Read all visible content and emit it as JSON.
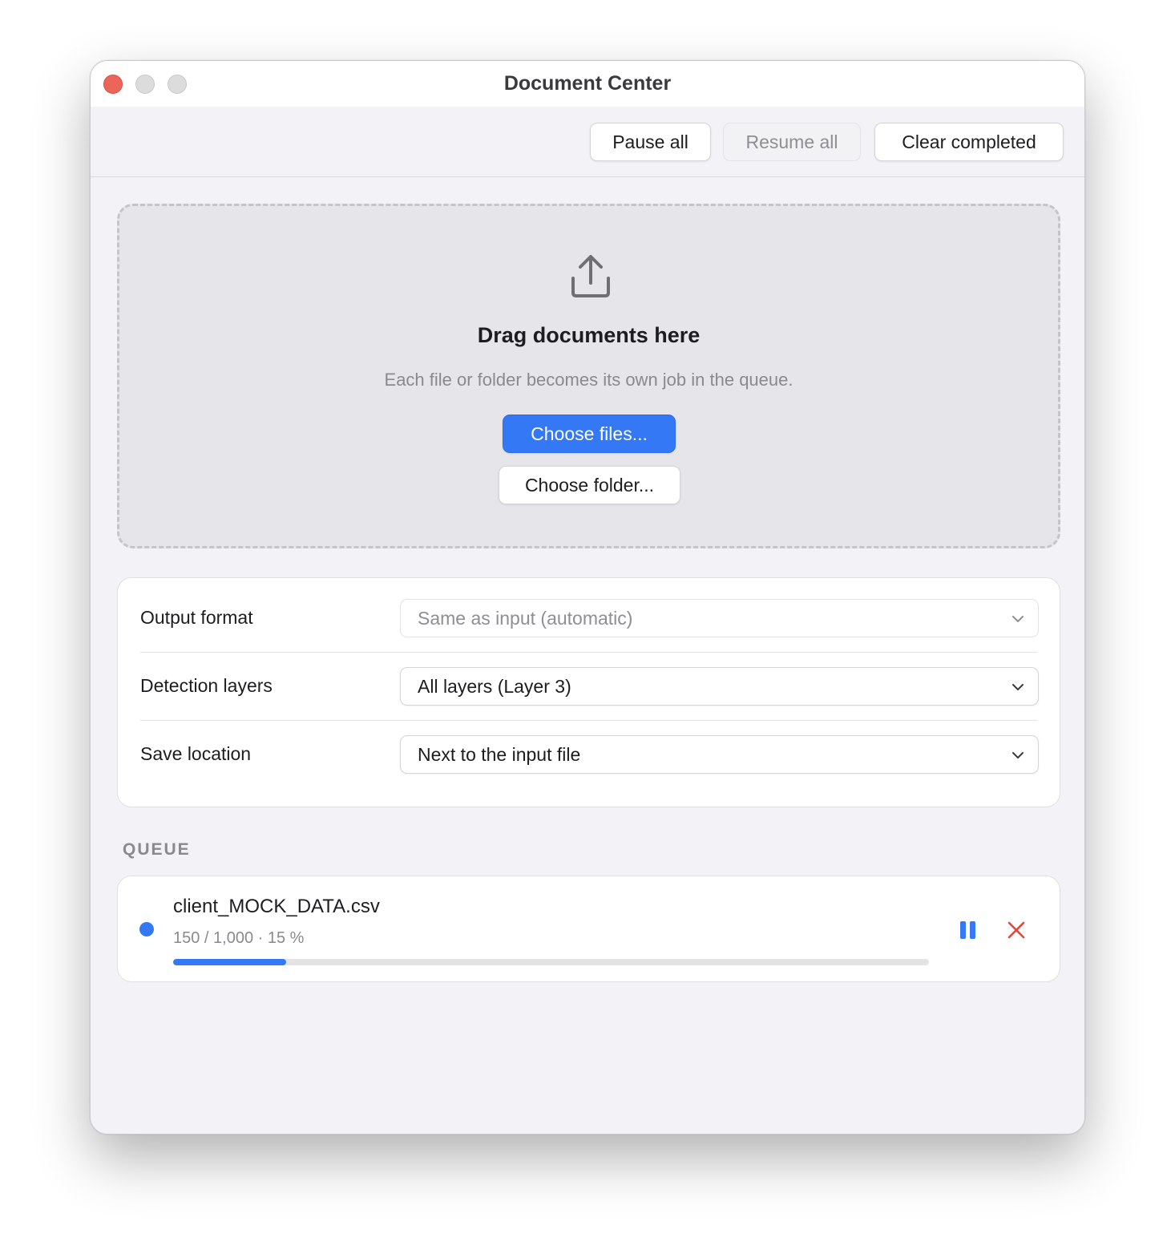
{
  "window": {
    "title": "Document Center"
  },
  "toolbar": {
    "pause_all": "Pause all",
    "resume_all": "Resume all",
    "clear_completed": "Clear completed"
  },
  "dropzone": {
    "icon": "upload-icon",
    "title": "Drag documents here",
    "subtitle": "Each file or folder becomes its own job in the queue.",
    "choose_files": "Choose files...",
    "choose_folder": "Choose folder..."
  },
  "settings": {
    "rows": [
      {
        "label": "Output format",
        "value": "Same as input (automatic)",
        "disabled": true
      },
      {
        "label": "Detection layers",
        "value": "All layers (Layer 3)",
        "disabled": false
      },
      {
        "label": "Save location",
        "value": "Next to the input file",
        "disabled": false
      }
    ]
  },
  "queue": {
    "heading": "QUEUE",
    "items": [
      {
        "file_name": "client_MOCK_DATA.csv",
        "progress_text": "150 / 1,000 · 15 %",
        "progress_fraction": 0.15,
        "status_color": "#3478f6"
      }
    ]
  },
  "colors": {
    "accent": "#3478f6",
    "danger": "#e2493b",
    "window_bg": "#f2f2f7"
  }
}
